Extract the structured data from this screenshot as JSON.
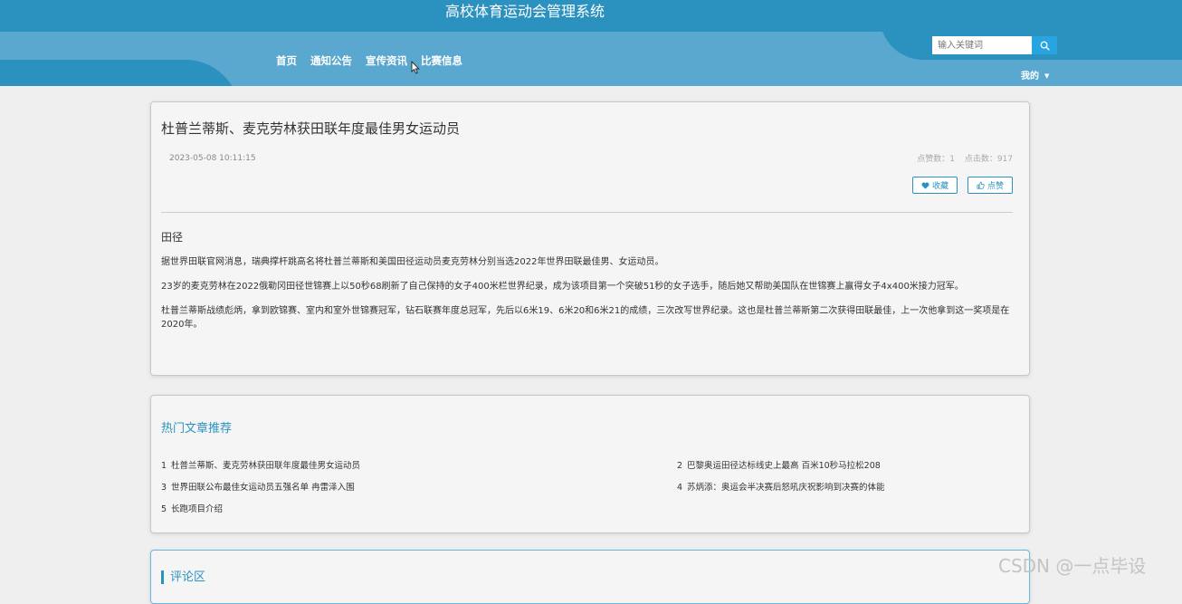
{
  "header": {
    "site_title": "高校体育运动会管理系统",
    "nav": [
      "首页",
      "通知公告",
      "宣传资讯",
      "比赛信息"
    ],
    "search_placeholder": "输入关键词",
    "user_menu": "我的"
  },
  "article": {
    "title": "杜普兰蒂斯、麦克劳林获田联年度最佳男女运动员",
    "time": "2023-05-08 10:11:15",
    "likes_label": "点赞数：1",
    "clicks_label": "点击数：917",
    "favorite_label": "收藏",
    "like_label": "点赞",
    "category": "田径",
    "paragraphs": [
      "据世界田联官网消息，瑞典撑杆跳高名将杜普兰蒂斯和美国田径运动员麦克劳林分别当选2022年世界田联最佳男、女运动员。",
      "23岁的麦克劳林在2022俄勒冈田径世锦赛上以50秒68刷新了自己保持的女子400米栏世界纪录，成为该项目第一个突破51秒的女子选手，随后她又帮助美国队在世锦赛上赢得女子4x400米接力冠军。",
      "杜普兰蒂斯战绩彪炳，拿到欧锦赛、室内和室外世锦赛冠军，钻石联赛年度总冠军，先后以6米19、6米20和6米21的成绩，三次改写世界纪录。这也是杜普兰蒂斯第二次获得田联最佳，上一次他拿到这一奖项是在2020年。"
    ]
  },
  "hot": {
    "title": "热门文章推荐",
    "items": [
      {
        "num": "1",
        "text": "杜普兰蒂斯、麦克劳林获田联年度最佳男女运动员"
      },
      {
        "num": "2",
        "text": "巴黎奥运田径达标线史上最高 百米10秒马拉松208"
      },
      {
        "num": "3",
        "text": "世界田联公布最佳女运动员五强名单 冉雷泽入围"
      },
      {
        "num": "4",
        "text": "苏炳添：奥运会半决赛后怒吼庆祝影响到决赛的体能"
      },
      {
        "num": "5",
        "text": "长跑项目介绍"
      }
    ]
  },
  "comments": {
    "title": "评论区"
  },
  "watermark": "CSDN @一点毕设",
  "colors": {
    "primary": "#2b92c0",
    "header_light": "#5aa8cf",
    "background": "#efefef"
  }
}
